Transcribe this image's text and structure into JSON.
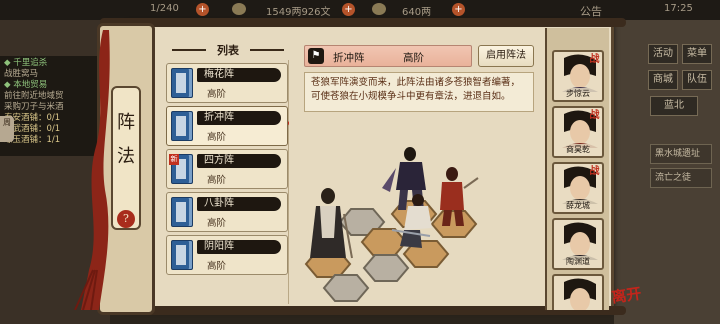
{
  "hud": {
    "stamina": "1/240",
    "silver": "1549两926文",
    "gold": "640两",
    "announce": "公告",
    "time": "17:25"
  },
  "quest_log": [
    {
      "text": "◆ 千里追杀",
      "style": "q-h"
    },
    {
      "text": "战胜窝马",
      "style": ""
    },
    {
      "text": "◆ 本地贸易",
      "style": "q-h"
    },
    {
      "text": "前往附近地域贸",
      "style": ""
    },
    {
      "text": "采购刀子与米酒",
      "style": ""
    },
    {
      "text": "泰安酒铺：0/1",
      "style": "q-g"
    },
    {
      "text": "宝武酒铺：0/1",
      "style": "q-g"
    },
    {
      "text": "琼玉酒铺：1/1",
      "style": "q-g"
    }
  ],
  "side_tab": "周",
  "right_menu": {
    "b1": "活动",
    "b2": "菜单",
    "b3": "商城",
    "b4": "队伍",
    "region": "蓝北",
    "task1": "黑水城遗址",
    "task2": "流亡之徒"
  },
  "exit_seal": "离开",
  "panel": {
    "title_char1": "阵",
    "title_char2": "法",
    "help": "?",
    "list_heading": "列表"
  },
  "formations": [
    {
      "name": "梅花阵",
      "rank": "高阶",
      "new": false,
      "selected": false,
      "checked": false
    },
    {
      "name": "折冲阵",
      "rank": "高阶",
      "new": false,
      "selected": true,
      "checked": true
    },
    {
      "name": "四方阵",
      "rank": "高阶",
      "new": true,
      "selected": false,
      "checked": false
    },
    {
      "name": "八卦阵",
      "rank": "高阶",
      "new": false,
      "selected": false,
      "checked": false
    },
    {
      "name": "阴阳阵",
      "rank": "高阶",
      "new": false,
      "selected": false,
      "checked": false
    }
  ],
  "new_label": "新",
  "detail": {
    "icon": "flag-icon",
    "name": "折冲阵",
    "rank": "高阶",
    "use_button": "启用阵法",
    "description": "苍狼军阵演变而来，此阵法由诸多苍狼智者编著，可使苍狼在小规模争斗中更有章法，进退自如。"
  },
  "heroes": [
    {
      "name": "步惊云",
      "badge": "战",
      "color": "#3b2f4a"
    },
    {
      "name": "商昊乾",
      "badge": "战",
      "color": "#7a2a1e"
    },
    {
      "name": "薛龙城",
      "badge": "战",
      "color": "#2f2a26"
    },
    {
      "name": "陶渊道",
      "badge": "",
      "color": "#1f1c22"
    },
    {
      "name": "",
      "badge": "",
      "color": "#4a2c28"
    }
  ],
  "colors": {
    "parchment": "#e6dac0",
    "accent_red": "#c0301f",
    "dark_ink": "#1e1710",
    "book_blue": "#2e5f96"
  }
}
